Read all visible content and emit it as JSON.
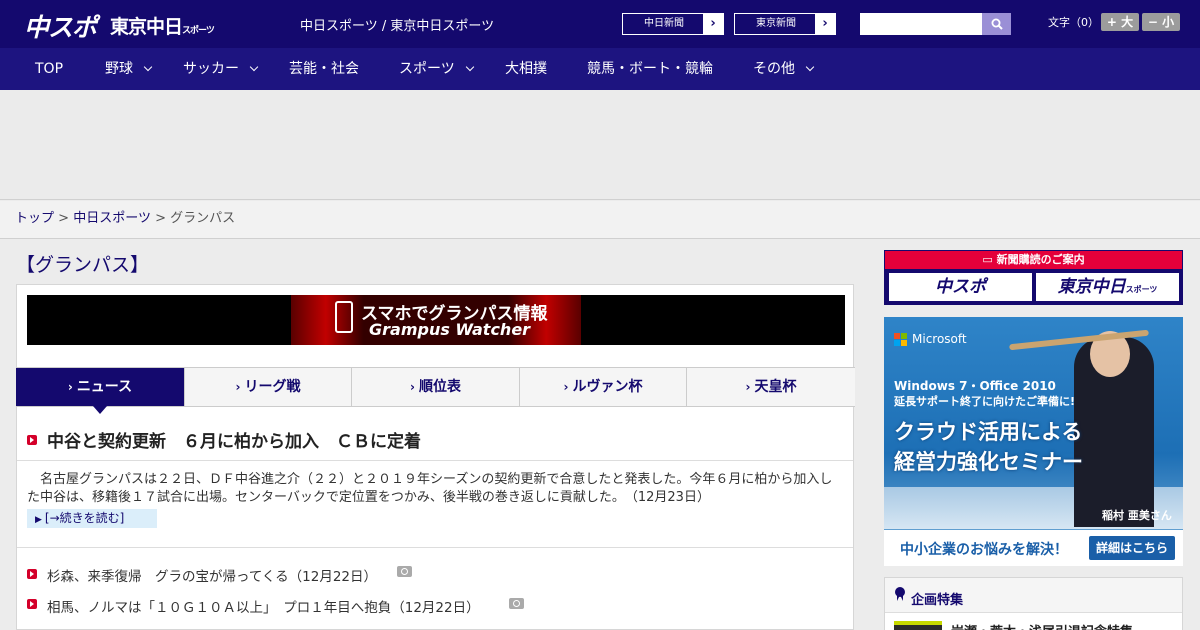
{
  "header": {
    "logo_main": "中スポ",
    "logo_tokyo": "東京中日",
    "logo_tokyo_sub": "スポーツ",
    "site_description": "中日スポーツ / 東京中日スポーツ",
    "links": [
      {
        "label": "中日新聞"
      },
      {
        "label": "東京新聞"
      }
    ],
    "search": {
      "placeholder": ""
    },
    "fontsize_label": "文字（0）",
    "fontsize_larger": "+ 大",
    "fontsize_smaller": "− 小"
  },
  "nav": {
    "items": [
      {
        "label": "TOP",
        "dropdown": false
      },
      {
        "label": "野球",
        "dropdown": true
      },
      {
        "label": "サッカー",
        "dropdown": true
      },
      {
        "label": "芸能・社会",
        "dropdown": false
      },
      {
        "label": "スポーツ",
        "dropdown": true
      },
      {
        "label": "大相撲",
        "dropdown": false
      },
      {
        "label": "競馬・ボート・競輪",
        "dropdown": false
      },
      {
        "label": "その他",
        "dropdown": true
      }
    ]
  },
  "breadcrumb": {
    "home": "トップ",
    "sep": ">",
    "section": "中日スポーツ",
    "current": "グランパス"
  },
  "page": {
    "title": "【グランパス】"
  },
  "banner": {
    "line1": "スマホでグランパス情報",
    "line2": "Grampus Watcher"
  },
  "tabs": [
    {
      "label": "ニュース",
      "active": true
    },
    {
      "label": "リーグ戦",
      "active": false
    },
    {
      "label": "順位表",
      "active": false
    },
    {
      "label": "ルヴァン杯",
      "active": false
    },
    {
      "label": "天皇杯",
      "active": false
    }
  ],
  "top_story": {
    "headline": "中谷と契約更新　６月に柏から加入　ＣＢに定着",
    "lead": "名古屋グランパスは２２日、ＤＦ中谷進之介（２２）と２０１９年シーズンの契約更新で合意したと発表した。今年６月に柏から加入した中谷は、移籍後１７試合に出場。センターバックで定位置をつかみ、後半戦の巻き返しに貢献した。　（12月23日）",
    "more": "[→続きを読む]"
  },
  "news": [
    {
      "title": "杉森、来季復帰　グラの宝が帰ってくる（12月22日）",
      "photo": true
    },
    {
      "title": "相馬、ノルマは「１０Ｇ１０Ａ以上」　プロ１年目へ抱負（12月22日）",
      "photo": true
    }
  ],
  "sidebar": {
    "subscription_header": "新聞購読のご案内",
    "subscription_chuspo": "中スポ",
    "subscription_tokyo": "東京中日",
    "subscription_tokyo_sub": "スポーツ",
    "ad": {
      "brand": "Microsoft",
      "line1": "Windows 7・Office 2010",
      "line2": "延長サポート終了に向けたご準備に!",
      "headline1": "クラウド活用による",
      "headline2": "経営力強化セミナー",
      "person": "稲村 亜美さん",
      "question": "中小企業のお悩みを解決！",
      "button": "詳細はこちら"
    },
    "feature_title": "企画特集",
    "feature_item": "岩瀬・荒木・浅尾引退記念特集"
  },
  "colors": {
    "brand_navy": "#14096e",
    "accent_red": "#d4002a",
    "ad_blue": "#1d6fb5"
  }
}
